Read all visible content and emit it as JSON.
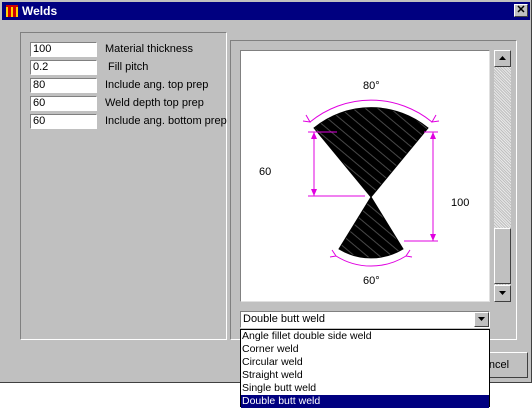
{
  "window": {
    "title": "Welds",
    "close_symbol": "✕"
  },
  "fields": [
    {
      "value": "100",
      "label": "Material thickness"
    },
    {
      "value": "0.2",
      "label": "Fill pitch"
    },
    {
      "value": "80",
      "label": "Include ang. top prep"
    },
    {
      "value": "60",
      "label": "Weld depth top prep"
    },
    {
      "value": "60",
      "label": "Include ang. bottom prep"
    }
  ],
  "preview": {
    "top_angle": "80°",
    "bottom_angle": "60°",
    "left_dimension": "60",
    "right_dimension": "100",
    "weld_color": "#000000",
    "dimension_color": "#e000e0"
  },
  "weld_type": {
    "selected": "Double butt weld",
    "options": [
      "Angle fillet double side weld",
      "Corner weld",
      "Circular weld",
      "Straight weld",
      "Single butt weld",
      "Double butt weld"
    ],
    "highlighted_option": "Double butt weld"
  },
  "buttons": {
    "cancel_partial": "ncel"
  },
  "colors": {
    "titlebar": "#000080",
    "face": "#c0c0c0",
    "highlight": "#000080"
  }
}
